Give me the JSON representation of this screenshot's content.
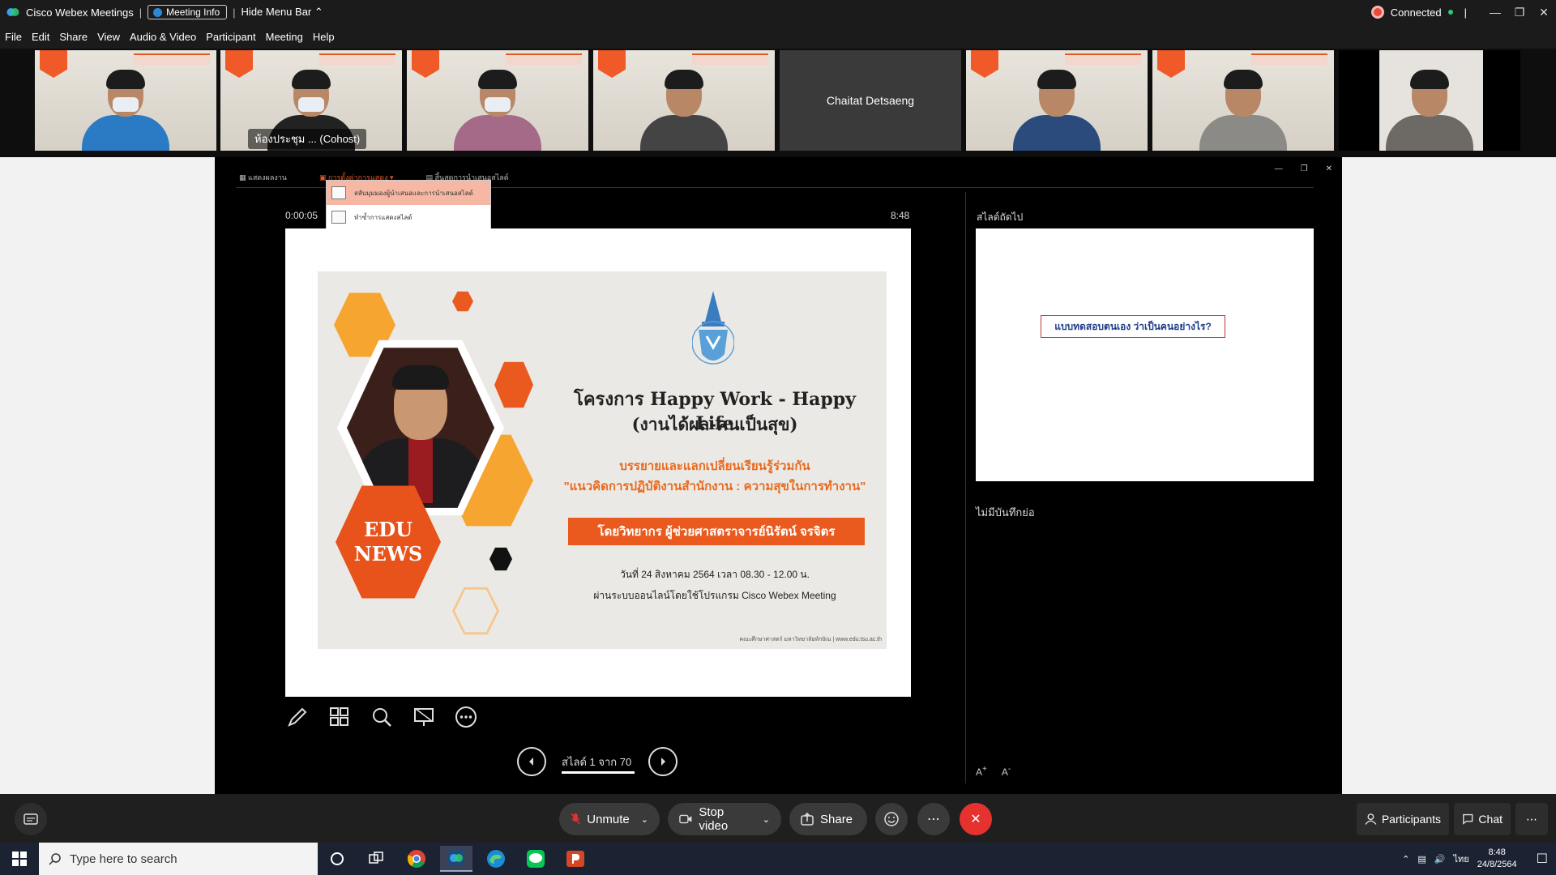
{
  "titlebar": {
    "app_name": "Cisco Webex Meetings",
    "meeting_info": "Meeting Info",
    "hide_menu": "Hide Menu Bar",
    "status": "Connected"
  },
  "menubar": {
    "items": [
      "File",
      "Edit",
      "Share",
      "View",
      "Audio & Video",
      "Participant",
      "Meeting",
      "Help"
    ]
  },
  "participants": [
    {
      "name": ""
    },
    {
      "name": "ห้องประชุม ... (Cohost)"
    },
    {
      "name": ""
    },
    {
      "name": ""
    },
    {
      "name": "Chaitat Detsaeng"
    },
    {
      "name": ""
    },
    {
      "name": ""
    },
    {
      "name": ""
    }
  ],
  "presenter": {
    "toolbar": [
      "แสดงผลงาน",
      "การตั้งค่าการแสดง ▾",
      "สิ้นสุดการนำเสนอสไลด์"
    ],
    "dropdown": [
      "สลับมุมมองผู้นำเสนอและการนำเสนอสไลด์",
      "ทำซ้ำการแสดงสไลด์"
    ],
    "timer": "0:00:05",
    "clock": "8:48",
    "next_label": "สไลด์ถัดไป",
    "notes": "ไม่มีบันทึกย่อ",
    "slide_counter": "สไลด์ 1 จาก 70",
    "font_up": "A",
    "font_down": "A"
  },
  "slide": {
    "title1": "โครงการ Happy Work - Happy Life",
    "title2": "(งานได้ผล-คนเป็นสุข)",
    "subtitle1": "บรรยายและแลกเปลี่ยนเรียนรู้ร่วมกัน",
    "subtitle2": "\"แนวคิดการปฏิบัติงานสำนักงาน : ความสุขในการทำงาน\"",
    "speaker": "โดยวิทยากร ผู้ช่วยศาสตราจารย์นิรัตน์ จรจิตร",
    "date": "วันที่ 24 สิงหาคม 2564 เวลา 08.30 - 12.00 น.",
    "platform": "ผ่านระบบออนไลน์โดยใช้โปรแกรม Cisco Webex Meeting",
    "footer": "คณะศึกษาศาสตร์ มหาวิทยาลัยทักษิณ | www.edu.tsu.ac.th",
    "badge_line1": "EDU",
    "badge_line2": "NEWS"
  },
  "next_slide": {
    "text": "แบบทดสอบตนเอง ว่าเป็นคนอย่างไร?"
  },
  "controls": {
    "unmute": "Unmute",
    "stop_video": "Stop video",
    "share": "Share",
    "participants": "Participants",
    "chat": "Chat"
  },
  "taskbar": {
    "search_placeholder": "Type here to search",
    "lang": "ไทย",
    "time": "8:48",
    "date": "24/8/2564"
  },
  "colors": {
    "accent": "#e8521b",
    "end_call": "#e6322e",
    "active_outline": "#22a7e0"
  }
}
